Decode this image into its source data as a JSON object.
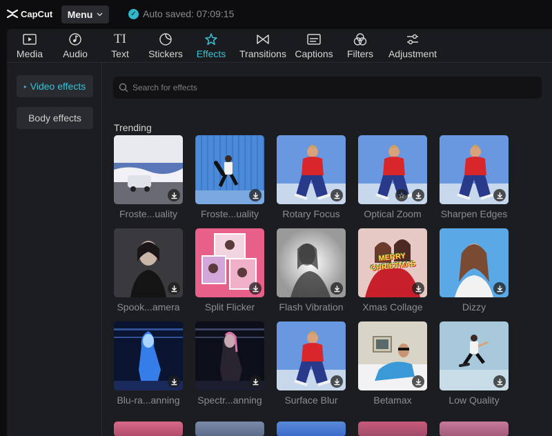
{
  "app": {
    "name": "CapCut",
    "menu_label": "Menu",
    "autosave_text": "Auto saved: 07:09:15"
  },
  "tabs": [
    {
      "label": "Media",
      "icon": "media-icon"
    },
    {
      "label": "Audio",
      "icon": "audio-icon"
    },
    {
      "label": "Text",
      "icon": "text-icon",
      "glyph": "TI"
    },
    {
      "label": "Stickers",
      "icon": "stickers-icon"
    },
    {
      "label": "Effects",
      "icon": "effects-icon",
      "active": true
    },
    {
      "label": "Transitions",
      "icon": "transitions-icon"
    },
    {
      "label": "Captions",
      "icon": "captions-icon"
    },
    {
      "label": "Filters",
      "icon": "filters-icon"
    },
    {
      "label": "Adjustment",
      "icon": "adjustment-icon"
    }
  ],
  "sidebar": {
    "items": [
      {
        "label": "Video effects",
        "active": true
      },
      {
        "label": "Body effects",
        "active": false
      }
    ]
  },
  "search": {
    "placeholder": "Search for effects"
  },
  "section": {
    "title": "Trending"
  },
  "effects": [
    {
      "label": "Froste...uality",
      "thumb": "snow-car"
    },
    {
      "label": "Froste...uality",
      "thumb": "skater-blue"
    },
    {
      "label": "Rotary Focus",
      "thumb": "man-red-shirt"
    },
    {
      "label": "Optical Zoom",
      "thumb": "man-red-shirt",
      "favorite": true
    },
    {
      "label": "Sharpen Edges",
      "thumb": "man-red-shirt"
    },
    {
      "label": "Spook...amera",
      "thumb": "woman-dark"
    },
    {
      "label": "Split Flicker",
      "thumb": "pink-collage"
    },
    {
      "label": "Flash Vibration",
      "thumb": "bw-woman"
    },
    {
      "label": "Xmas Collage",
      "thumb": "xmas-friends",
      "overlay_text": "MERRY CHRISTMAS"
    },
    {
      "label": "Dizzy",
      "thumb": "woman-blue-bg"
    },
    {
      "label": "Blu-ra...anning",
      "thumb": "neon-blue-figure"
    },
    {
      "label": "Spectr...anning",
      "thumb": "neon-dark-figure"
    },
    {
      "label": "Surface Blur",
      "thumb": "man-red-shirt"
    },
    {
      "label": "Betamax",
      "thumb": "retro-tv-woman"
    },
    {
      "label": "Low Quality",
      "thumb": "skater-light"
    }
  ],
  "colors": {
    "accent": "#36c3d6",
    "panel": "#1c1d21",
    "background": "#0d0d0f"
  }
}
